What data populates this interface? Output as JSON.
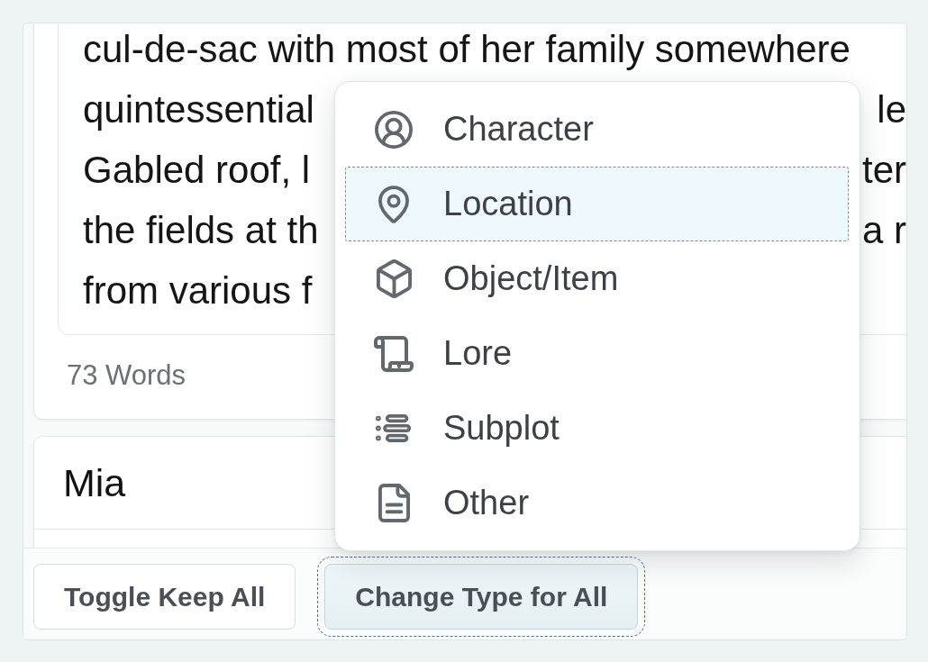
{
  "entries": [
    {
      "description_lines": [
        {
          "start": "cul-de-sac with most of her family somewhere"
        },
        {
          "start": "quintessential",
          "end": "le"
        },
        {
          "start": "Gabled roof, l",
          "end": "ter"
        },
        {
          "start": "the fields at th",
          "end": "a r"
        },
        {
          "start": "from various f"
        }
      ],
      "word_count": "73 Words"
    },
    {
      "name": "Mia"
    }
  ],
  "footer": {
    "buttons": [
      {
        "label": "Toggle Keep All",
        "expanded": false
      },
      {
        "label": "Change Type for All",
        "expanded": true
      }
    ]
  },
  "type_menu": {
    "items": [
      {
        "kind": "person",
        "label": "Character",
        "selected": false
      },
      {
        "kind": "pin",
        "label": "Location",
        "selected": true
      },
      {
        "kind": "cube",
        "label": "Object/Item",
        "selected": false
      },
      {
        "kind": "scroll",
        "label": "Lore",
        "selected": false
      },
      {
        "kind": "list",
        "label": "Subplot",
        "selected": false
      },
      {
        "kind": "document",
        "label": "Other",
        "selected": false
      }
    ]
  }
}
